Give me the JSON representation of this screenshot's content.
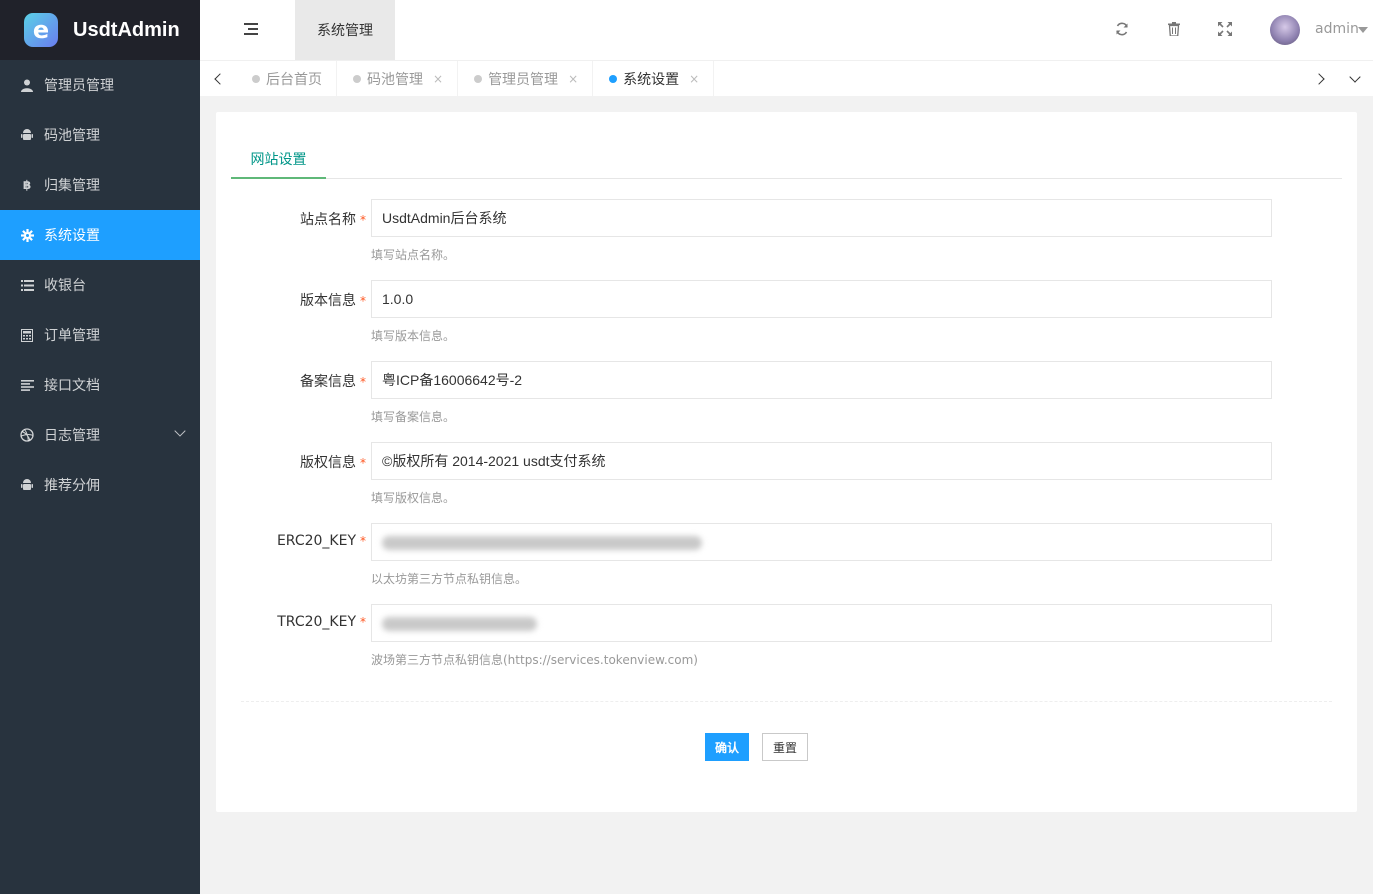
{
  "app": {
    "logo_letter": "e",
    "name": "UsdtAdmin"
  },
  "sidebar": {
    "items": [
      {
        "label": "管理员管理",
        "icon": "user-icon"
      },
      {
        "label": "码池管理",
        "icon": "android-icon"
      },
      {
        "label": "归集管理",
        "icon": "bitcoin-icon"
      },
      {
        "label": "系统设置",
        "icon": "gear-icon",
        "active": true
      },
      {
        "label": "收银台",
        "icon": "list-icon"
      },
      {
        "label": "订单管理",
        "icon": "calculator-icon"
      },
      {
        "label": "接口文档",
        "icon": "align-left-icon"
      },
      {
        "label": "日志管理",
        "icon": "dribbble-icon",
        "has_submenu": true
      },
      {
        "label": "推荐分佣",
        "icon": "android-icon"
      }
    ]
  },
  "header": {
    "top_tab": "系统管理",
    "icons": [
      "refresh-icon",
      "trash-icon",
      "fullscreen-icon"
    ],
    "username": "admin"
  },
  "tabbar": {
    "tabs": [
      {
        "label": "后台首页",
        "closable": false
      },
      {
        "label": "码池管理",
        "closable": true
      },
      {
        "label": "管理员管理",
        "closable": true
      },
      {
        "label": "系统设置",
        "closable": true,
        "active": true
      }
    ],
    "close_glyph": "×"
  },
  "settings": {
    "tab": "网站设置",
    "required_mark": "*",
    "fields": [
      {
        "label": "站点名称",
        "value": "UsdtAdmin后台系统",
        "tip": "填写站点名称。"
      },
      {
        "label": "版本信息",
        "value": "1.0.0",
        "tip": "填写版本信息。"
      },
      {
        "label": "备案信息",
        "value": "粤ICP备16006642号-2",
        "tip": "填写备案信息。"
      },
      {
        "label": "版权信息",
        "value": "©版权所有 2014-2021 usdt支付系统",
        "tip": "填写版权信息。"
      },
      {
        "label": "ERC20_KEY",
        "value": "",
        "tip": "以太坊第三方节点私钥信息。"
      },
      {
        "label": "TRC20_KEY",
        "value": "",
        "tip": "波场第三方节点私钥信息(https://services.tokenview.com)"
      }
    ],
    "confirm_button": "确认",
    "reset_button": "重置"
  },
  "colors": {
    "primary": "#1e9fff",
    "sidebar_bg": "#28333e",
    "logo_bg": "#20222a",
    "tab_accent": "#009688",
    "tab_underline": "#5fb878",
    "required": "#ff5722"
  }
}
